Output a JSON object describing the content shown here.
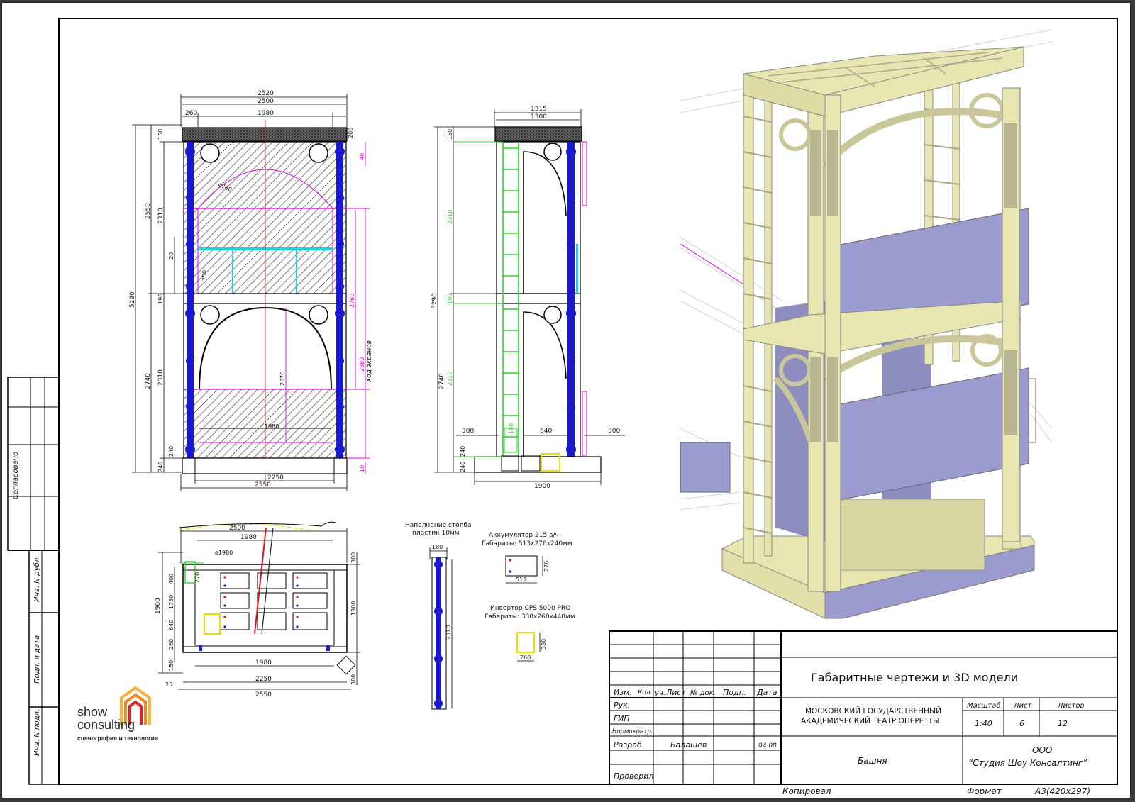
{
  "colors": {
    "structure_blue": "#1a1acc",
    "cad_magenta": "#e000e0",
    "cad_green": "#2ad42a",
    "cad_cyan": "#22cfe0",
    "cad_yellow": "#e8e000",
    "model_beige": "#e8e6b0",
    "model_panel": "#9b9bd0",
    "logo_orange": "#f08a1c",
    "logo_red": "#d8262b"
  },
  "front_view": {
    "dims_top": [
      "2520",
      "2500",
      "260",
      "1980",
      "200"
    ],
    "dims_left": [
      "5290",
      "2550",
      "150",
      "2310",
      "20",
      "750",
      "190",
      "2740",
      "2310",
      "240",
      "240"
    ],
    "dims_right": [
      "40",
      "2760",
      "2880",
      "2070",
      "1980",
      "10"
    ],
    "travel_label": "Ход экранов",
    "dims_bottom": [
      "2250",
      "2550"
    ],
    "circle_dim": "ø760"
  },
  "side_view": {
    "dims_top": [
      "1315",
      "1300"
    ],
    "dims_left": [
      "5290",
      "150",
      "2310",
      "190",
      "2740",
      "2310",
      "240",
      "240"
    ],
    "dims_bottom": [
      "300",
      "640",
      "300",
      "1900"
    ],
    "small_label": "180"
  },
  "plan_view": {
    "dims_top": [
      "2500",
      "1980"
    ],
    "circle_dim": "ø1980",
    "dims_left": [
      "1900",
      "400",
      "1750",
      "640",
      "260",
      "150",
      "25"
    ],
    "dims_inner": [
      "270"
    ],
    "dims_right": [
      "300",
      "1300",
      "300"
    ],
    "dims_bottom": [
      "1980",
      "2250",
      "2550"
    ]
  },
  "column_detail": {
    "title_line1": "Наполнение столба",
    "title_line2": "пластик 10мм",
    "width_dim": "180",
    "height_dim": "2310"
  },
  "battery": {
    "title": "Аккумулятор 215 а/ч",
    "size": "Габариты: 513х276х240мм",
    "dim_w": "513",
    "dim_h": "276"
  },
  "inverter": {
    "title": "Инвертор CPS 5000 PRO",
    "size": "Габариты: 330х260х440мм",
    "dim_w": "260",
    "dim_h": "330"
  },
  "side_stamp": {
    "agreed": "Согласовано",
    "inv_dubl": "Инв. N дубл.",
    "podp_data": "Подп. и дата",
    "inv_podl": "Инв. N подл."
  },
  "logo": {
    "line1": "show",
    "line2": "consulting",
    "tagline": "сценография и технологии"
  },
  "title_block": {
    "headers": [
      "Изм.",
      "Кол.",
      "уч.",
      "Лист",
      "№ док.",
      "Подп.",
      "Дата"
    ],
    "roles": [
      "Рук.",
      "ГИП",
      "Нормоконтр.",
      "Разраб.",
      "Проверил"
    ],
    "developer": "Балашев",
    "date": "04.08",
    "drawing_title": "Габаритные чертежи и 3D модели",
    "organization_line1": "МОСКОВСКИЙ ГОСУДАРСТВЕННЫЙ",
    "organization_line2": "АКАДЕМИЧЕСКИЙ ТЕАТР ОПЕРЕТТЫ",
    "object": "Башня",
    "col_scale": "Масштаб",
    "col_sheet": "Лист",
    "col_sheets": "Листов",
    "scale": "1:40",
    "sheet": "6",
    "sheets": "12",
    "company_line1": "ООО",
    "company_line2": "“Студия Шоу Консалтинг”",
    "copied": "Копировал",
    "format_label": "Формат",
    "format_value": "А3(420х297)"
  }
}
